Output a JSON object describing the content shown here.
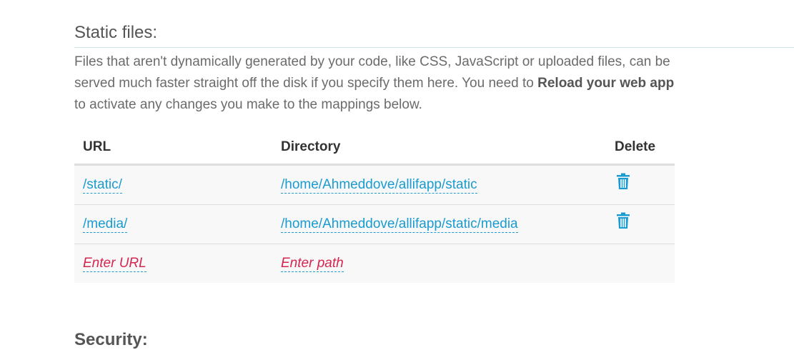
{
  "static_files": {
    "title": "Static files:",
    "description_part1": "Files that aren't dynamically generated by your code, like CSS, JavaScript or uploaded files, can be served much faster straight off the disk if you specify them here. You need to ",
    "description_bold": "Reload your web app",
    "description_part2": " to activate any changes you make to the mappings below.",
    "table": {
      "headers": {
        "url": "URL",
        "directory": "Directory",
        "delete": "Delete"
      },
      "rows": [
        {
          "url": "/static/",
          "directory": "/home/Ahmeddove/allifapp/static",
          "delete_icon": "trash-icon"
        },
        {
          "url": "/media/",
          "directory": "/home/Ahmeddove/allifapp/static/media",
          "delete_icon": "trash-icon"
        }
      ],
      "new_row": {
        "url_placeholder": "Enter URL",
        "path_placeholder": "Enter path"
      }
    }
  },
  "next_section": {
    "title": "Security:"
  },
  "colors": {
    "link": "#1a9bd1",
    "placeholder": "#d6264f",
    "header_rule": "#cfe3ea"
  }
}
